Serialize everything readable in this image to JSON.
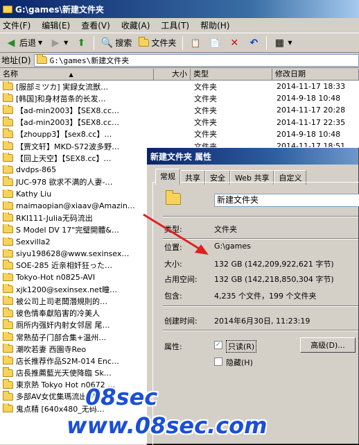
{
  "window": {
    "title": "G:\\games\\新建文件夹"
  },
  "menu": [
    "文件(F)",
    "编辑(E)",
    "查看(V)",
    "收藏(A)",
    "工具(T)",
    "帮助(H)"
  ],
  "toolbar": {
    "back": "后退",
    "search": "搜索",
    "folders": "文件夹"
  },
  "address": {
    "label": "地址(D)",
    "value": "G:\\games\\新建文件夹"
  },
  "columns": {
    "name": "名称",
    "size": "大小",
    "type": "类型",
    "modified": "修改日期"
  },
  "files": [
    {
      "name": "[服部ミツカ] 実録女流獣…",
      "type": "文件夹",
      "date": "2014-11-17 18:33"
    },
    {
      "name": "[韩国]和身材苗条的长发…",
      "type": "文件夹",
      "date": "2014-9-18 10:48"
    },
    {
      "name": "【ad-min2003】【SEX8.cc…",
      "type": "文件夹",
      "date": "2014-11-17 20:28"
    },
    {
      "name": "【ad-min2003】【SEX8.cc…",
      "type": "文件夹",
      "date": "2014-11-17 22:35"
    },
    {
      "name": "【zhoupp3】【sex8.cc】…",
      "type": "文件夹",
      "date": "2014-9-18 10:48"
    },
    {
      "name": "【贾文轩】MKD-S72波多野…",
      "type": "文件夹",
      "date": "2014-11-17 18:51"
    },
    {
      "name": "【回上天空】【SEX8.cc】…",
      "type": "",
      "date": ""
    },
    {
      "name": "dvdps-865",
      "type": "",
      "date": ""
    },
    {
      "name": "JUC-978 欲求不满的人妻-…",
      "type": "",
      "date": ""
    },
    {
      "name": "Kathy Liu",
      "type": "",
      "date": ""
    },
    {
      "name": "maimaopian@xiaav@Amazin…",
      "type": "",
      "date": ""
    },
    {
      "name": "RKI111-Julia无码流出",
      "type": "",
      "date": ""
    },
    {
      "name": "S Model DV 17\"完璧開體&…",
      "type": "",
      "date": ""
    },
    {
      "name": "Sexvilla2",
      "type": "",
      "date": ""
    },
    {
      "name": "siyu198628@www.sexinsex…",
      "type": "",
      "date": ""
    },
    {
      "name": "SOE-285 近亲相奸狂った…",
      "type": "",
      "date": ""
    },
    {
      "name": "Tokyo-Hot n0825-AVI",
      "type": "",
      "date": ""
    },
    {
      "name": "xjk1200@sexinsex.net瞳…",
      "type": "",
      "date": ""
    },
    {
      "name": "被公司上司老闆潛規則的…",
      "type": "",
      "date": ""
    },
    {
      "name": "彼色情奉獻陷害的冷美人",
      "type": "",
      "date": ""
    },
    {
      "name": "厕所内强奸内射女邻居 尾…",
      "type": "",
      "date": ""
    },
    {
      "name": "常熟茄子门部合集+温州…",
      "type": "",
      "date": ""
    },
    {
      "name": "潮吹若妻 西園寺Reo",
      "type": "",
      "date": ""
    },
    {
      "name": "店长推荐作品S2M-014 Enc…",
      "type": "",
      "date": ""
    },
    {
      "name": "店長推薦藍光天使降臨 Sk…",
      "type": "",
      "date": ""
    },
    {
      "name": "東京熱 Tokyo Hot n0672 …",
      "type": "",
      "date": ""
    },
    {
      "name": "多部AV女优集瑪流出OK…",
      "type": "",
      "date": ""
    },
    {
      "name": "鬼点精 [640x480_无码…",
      "type": "",
      "date": ""
    }
  ],
  "dialog": {
    "title": "新建文件夹 属性",
    "tabs": [
      "常规",
      "共享",
      "安全",
      "Web 共享",
      "自定义"
    ],
    "name": "新建文件夹",
    "type_label": "类型:",
    "type_value": "文件夹",
    "location_label": "位置:",
    "location_value": "G:\\games",
    "size_label": "大小:",
    "size_value": "132 GB (142,209,922,621 字节)",
    "disk_label": "占用空间:",
    "disk_value": "132 GB (142,218,850,304 字节)",
    "contains_label": "包含:",
    "contains_value": "4,235 个文件，199 个文件夹",
    "created_label": "创建时间:",
    "created_value": "2014年6月30日, 11:23:19",
    "attr_label": "属性:",
    "readonly_label": "只读(R)",
    "hidden_label": "隐藏(H)",
    "advanced_label": "高级(D)..."
  },
  "watermark": {
    "line1": "08sec",
    "line2": "www.08sec.com"
  },
  "colors": {
    "title_bar": "#0a246a",
    "folder": "#f7d35c",
    "arrow": "#e02020",
    "watermark": "#1a4fd6"
  }
}
